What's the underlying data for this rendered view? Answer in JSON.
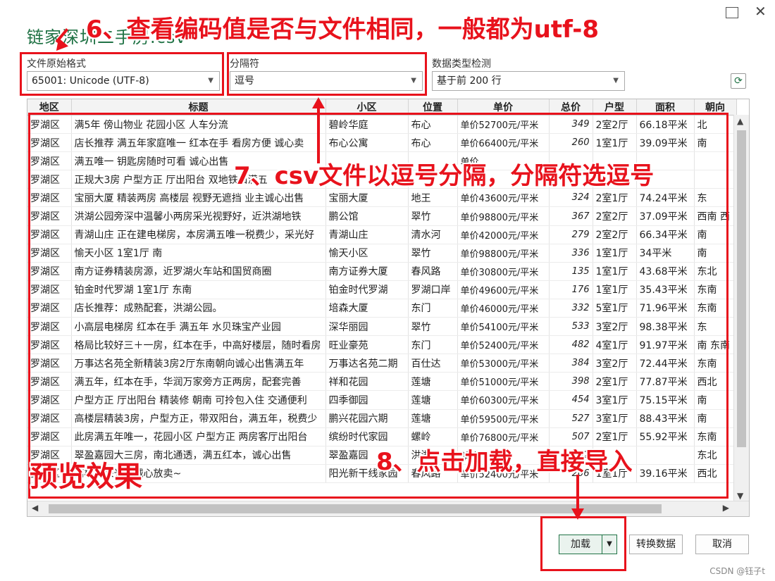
{
  "window": {
    "title": "链家深圳二手房.csv",
    "maximize_icon": "maximize-icon",
    "close_icon": "close-icon"
  },
  "options": {
    "file_origin_label": "文件原始格式",
    "file_origin_value": "65001: Unicode (UTF-8)",
    "delimiter_label": "分隔符",
    "delimiter_value": "逗号",
    "detection_label": "数据类型检测",
    "detection_value": "基于前 200 行"
  },
  "table": {
    "columns": [
      "地区",
      "标题",
      "小区",
      "位置",
      "单价",
      "总价",
      "户型",
      "面积",
      "朝向"
    ],
    "rows": [
      [
        "罗湖区",
        "满5年 傍山物业 花园小区 人车分流",
        "碧岭华庭",
        "布心",
        "单价52700元/平米",
        "349",
        "2室2厅",
        "66.18平米",
        "北"
      ],
      [
        "罗湖区",
        "店长推荐 满五年家庭唯一 红本在手 看房方便 诚心卖",
        "布心公寓",
        "布心",
        "单价66400元/平米",
        "260",
        "1室1厅",
        "39.09平米",
        "南"
      ],
      [
        "罗湖区",
        "满五唯一 钥匙房随时可看 诚心出售",
        "",
        "",
        "单价",
        "",
        "",
        "",
        ""
      ],
      [
        "罗湖区",
        "正规大3房 户型方正 厅出阳台 双地铁口满五",
        "",
        "",
        "",
        "",
        "",
        "",
        ""
      ],
      [
        "罗湖区",
        "宝丽大厦 精装两房 高楼层 视野无遮挡 业主诚心出售",
        "宝丽大厦",
        "地王",
        "单价43600元/平米",
        "324",
        "2室1厅",
        "74.24平米",
        "东"
      ],
      [
        "罗湖区",
        "洪湖公园旁深中温馨小两房采光视野好，近洪湖地铁",
        "鹏公馆",
        "翠竹",
        "单价98800元/平米",
        "367",
        "2室2厅",
        "37.09平米",
        "西南 西"
      ],
      [
        "罗湖区",
        "青湖山庄 正在建电梯房，本房满五唯一税费少，采光好",
        "青湖山庄",
        "清水河",
        "单价42000元/平米",
        "279",
        "2室2厅",
        "66.34平米",
        "南"
      ],
      [
        "罗湖区",
        "愉天小区 1室1厅 南",
        "愉天小区",
        "翠竹",
        "单价98800元/平米",
        "336",
        "1室1厅",
        "34平米",
        "南"
      ],
      [
        "罗湖区",
        "南方证券精装房源，近罗湖火车站和国贸商圈",
        "南方证券大厦",
        "春风路",
        "单价30800元/平米",
        "135",
        "1室1厅",
        "43.68平米",
        "东北"
      ],
      [
        "罗湖区",
        "铂金时代罗湖 1室1厅 东南",
        "铂金时代罗湖",
        "罗湖口岸",
        "单价49600元/平米",
        "176",
        "1室1厅",
        "35.43平米",
        "东南"
      ],
      [
        "罗湖区",
        "店长推荐：成熟配套，洪湖公园。",
        "培森大厦",
        "东门",
        "单价46000元/平米",
        "332",
        "5室1厅",
        "71.96平米",
        "东南"
      ],
      [
        "罗湖区",
        "小高层电梯房 红本在手 满五年 水贝珠宝产业园",
        "深华丽园",
        "翠竹",
        "单价54100元/平米",
        "533",
        "3室2厅",
        "98.38平米",
        "东"
      ],
      [
        "罗湖区",
        "格局比较好三＋一房，红本在手，中高好楼层，随时看房",
        "旺业豪苑",
        "东门",
        "单价52400元/平米",
        "482",
        "4室1厅",
        "91.97平米",
        "南 东南"
      ],
      [
        "罗湖区",
        "万事达名苑全新精装3房2厅东南朝向诚心出售满五年",
        "万事达名苑二期",
        "百仕达",
        "单价53000元/平米",
        "384",
        "3室2厅",
        "72.44平米",
        "东南"
      ],
      [
        "罗湖区",
        "满五年，红本在手，华润万家旁方正两房，配套完善",
        "祥和花园",
        "莲塘",
        "单价51000元/平米",
        "398",
        "2室1厅",
        "77.87平米",
        "西北"
      ],
      [
        "罗湖区",
        "户型方正 厅出阳台 精装修 朝南 可拎包入住 交通便利",
        "四季御园",
        "莲塘",
        "单价60300元/平米",
        "454",
        "3室1厅",
        "75.15平米",
        "南"
      ],
      [
        "罗湖区",
        "高楼层精装3房，户型方正，带双阳台，满五年，税费少",
        "鹏兴花园六期",
        "莲塘",
        "单价59500元/平米",
        "527",
        "3室1厅",
        "88.43平米",
        "南"
      ],
      [
        "罗湖区",
        "此房满五年唯一，花园小区 户型方正 两房客厅出阳台",
        "缤纷时代家园",
        "螺岭",
        "单价76800元/平米",
        "507",
        "2室1厅",
        "55.92平米",
        "东南"
      ],
      [
        "罗湖区",
        "翠盈嘉园大三房，南北通透，满五红本，诚心出售",
        "翠盈嘉园",
        "洪湖",
        "单价",
        "582",
        "",
        "",
        "东北"
      ],
      [
        "罗湖区",
        "高楼层采光好诚心放卖~",
        "阳光新干线家园",
        "春风路",
        "单价52400元/平米",
        "206",
        "1室1厅",
        "39.16平米",
        "西北"
      ]
    ]
  },
  "buttons": {
    "load": "加载",
    "transform": "转换数据",
    "cancel": "取消"
  },
  "annotations": {
    "step6": "6、查看编码值是否与文件相同，一般都为utf-8",
    "step7": "7、csv文件以逗号分隔，分隔符选逗号",
    "step8": "8、点击加载，直接导入",
    "preview": "预览效果"
  },
  "watermark": "CSDN @钰子t",
  "colors": {
    "accent": "#217346",
    "annotation": "#e8121c"
  }
}
